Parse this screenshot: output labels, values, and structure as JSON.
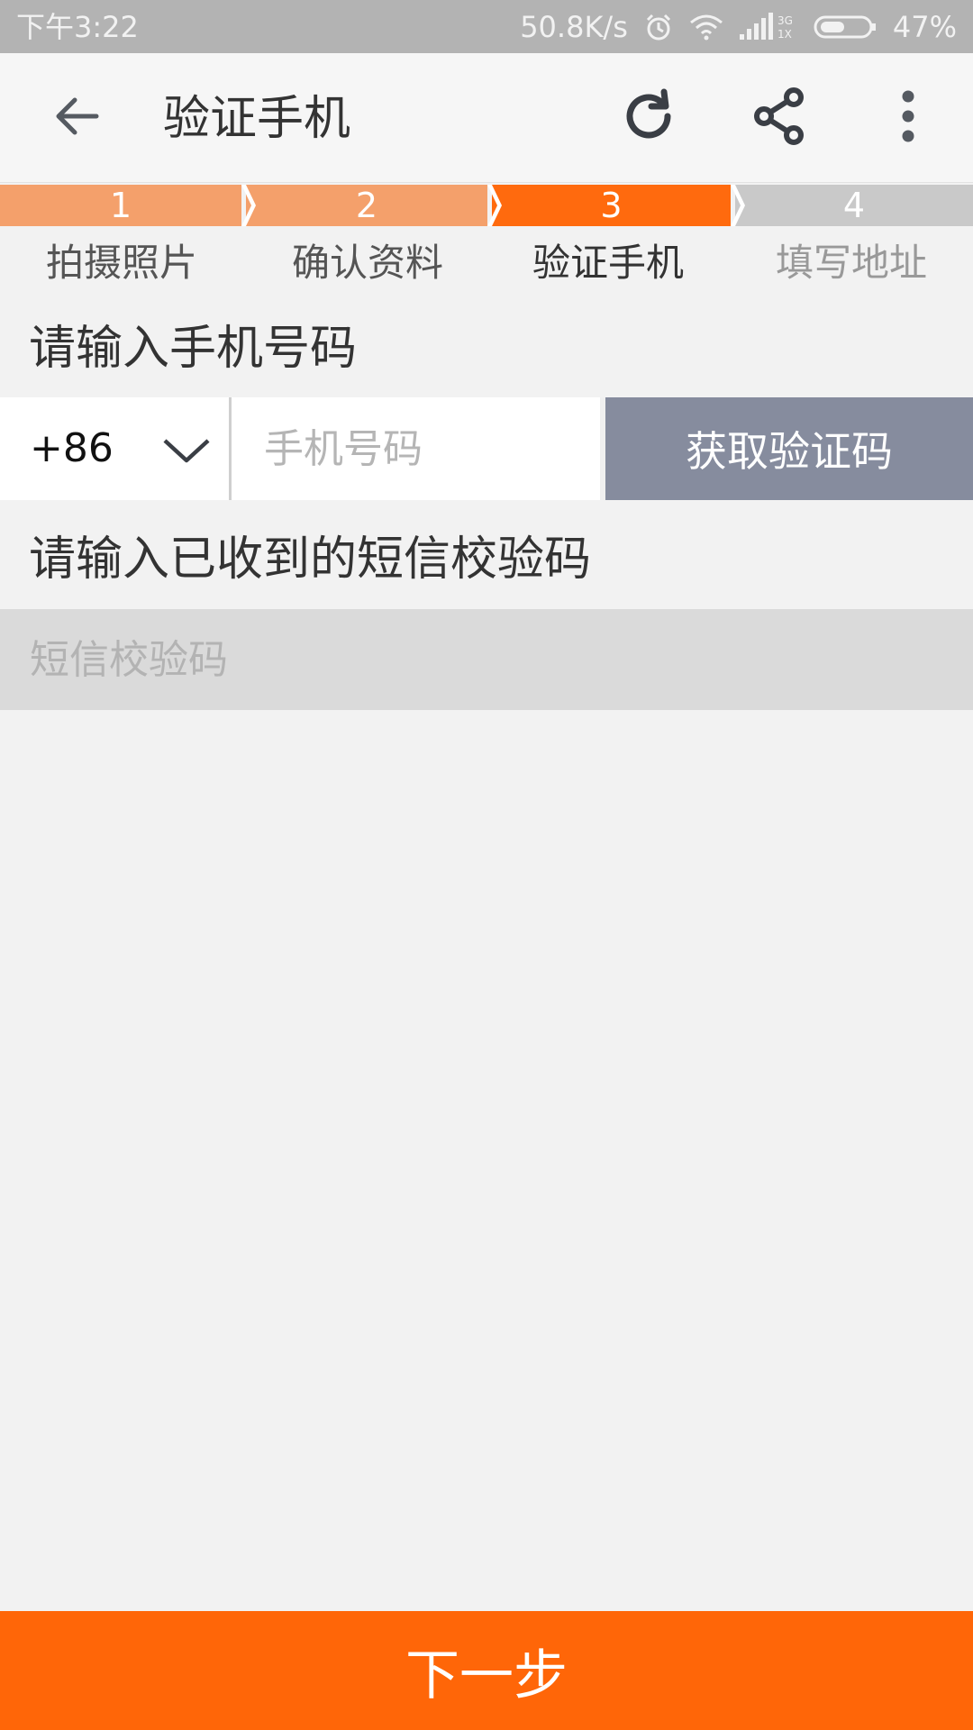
{
  "status_bar": {
    "time": "下午3:22",
    "network_speed": "50.8K/s",
    "battery": "47%",
    "icons": [
      "alarm-icon",
      "wifi-icon",
      "signal-icon",
      "battery-icon"
    ],
    "network_type_top": "3G",
    "network_type_bottom": "1X"
  },
  "app_bar": {
    "title": "验证手机",
    "icons": [
      "back-arrow-icon",
      "refresh-icon",
      "share-icon",
      "more-vert-icon"
    ]
  },
  "stepper": {
    "steps": [
      {
        "number": "1",
        "label": "拍摄照片",
        "state": "done"
      },
      {
        "number": "2",
        "label": "确认资料",
        "state": "done"
      },
      {
        "number": "3",
        "label": "验证手机",
        "state": "active"
      },
      {
        "number": "4",
        "label": "填写地址",
        "state": "pending"
      }
    ]
  },
  "phone_section": {
    "heading": "请输入手机号码",
    "country_code": "+86",
    "phone_placeholder": "手机号码",
    "get_code_label": "获取验证码"
  },
  "sms_section": {
    "heading": "请输入已收到的短信校验码",
    "code_placeholder": "短信校验码"
  },
  "footer": {
    "next_label": "下一步"
  },
  "colors": {
    "accent": "#ff6608",
    "step_done": "#f4a06b",
    "step_active": "#ff6a0e",
    "step_pending": "#c9c9c9",
    "get_code_button": "#868c9e",
    "background": "#f2f2f2"
  }
}
